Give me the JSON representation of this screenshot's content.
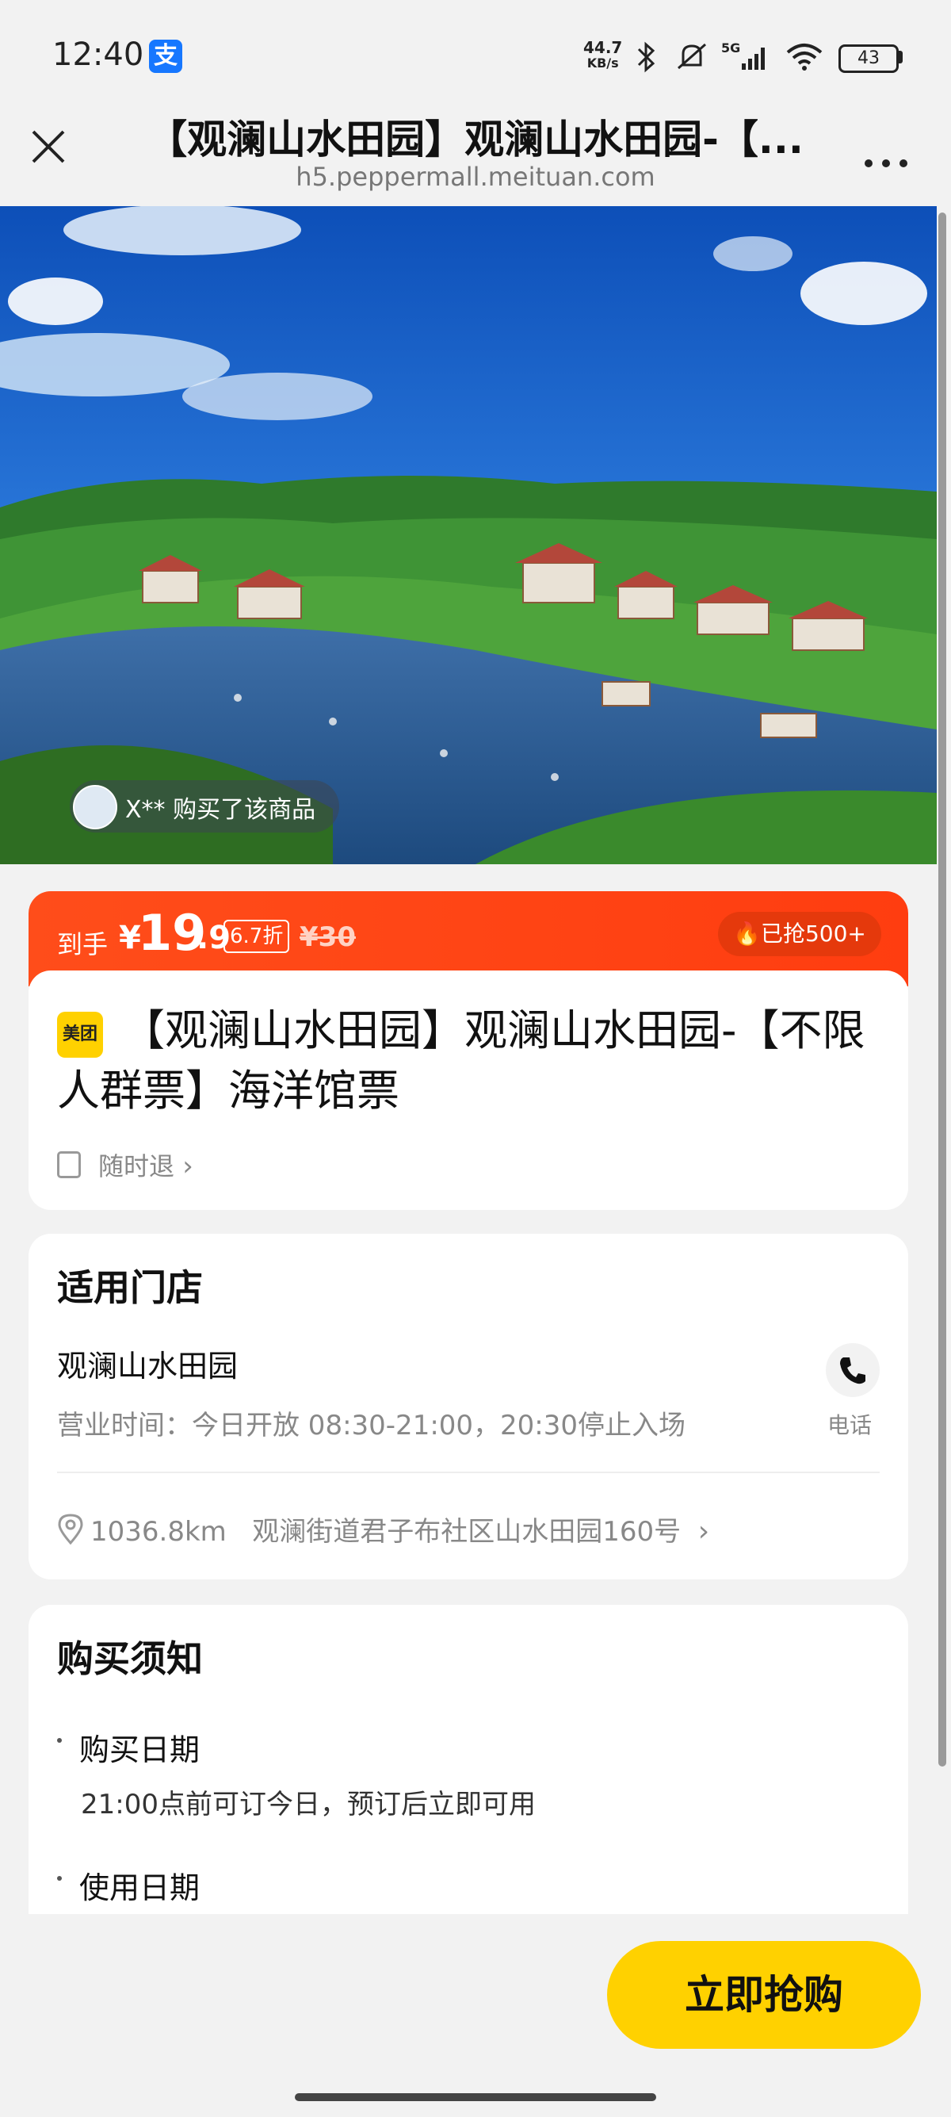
{
  "status_bar": {
    "time": "12:40",
    "app_badge": "支",
    "net_speed_value": "44.7",
    "net_speed_unit": "KB/s",
    "network_type": "5G",
    "battery": "43"
  },
  "nav": {
    "title": "【观澜山水田园】观澜山水田园-【...",
    "url": "h5.peppermall.meituan.com"
  },
  "hero": {
    "buyer_notice": "X** 购买了该商品"
  },
  "price": {
    "prefix": "到手",
    "currency": "¥",
    "integer": "19",
    "decimal": ".9",
    "discount": "6.7折",
    "original": "¥30",
    "sold": "已抢500+"
  },
  "product": {
    "brand_badge": "美团",
    "title": "【观澜山水田园】观澜山水田园-【不限人群票】海洋馆票",
    "refund": "随时退"
  },
  "store": {
    "section_title": "适用门店",
    "name": "观澜山水田园",
    "hours": "营业时间：今日开放 08:30-21:00，20:30停止入场",
    "phone_label": "电话",
    "distance": "1036.8km",
    "address": "观澜街道君子布社区山水田园160号"
  },
  "notice": {
    "section_title": "购买须知",
    "items": [
      {
        "heading": "购买日期",
        "body": "21:00点前可订今日，预订后立即可用"
      },
      {
        "heading": "使用日期",
        "body": ""
      }
    ]
  },
  "cta": {
    "buy_label": "立即抢购"
  },
  "colors": {
    "price_bar": "#ff4d1a",
    "buy_button": "#ffd100",
    "brand_yellow": "#ffd100"
  }
}
